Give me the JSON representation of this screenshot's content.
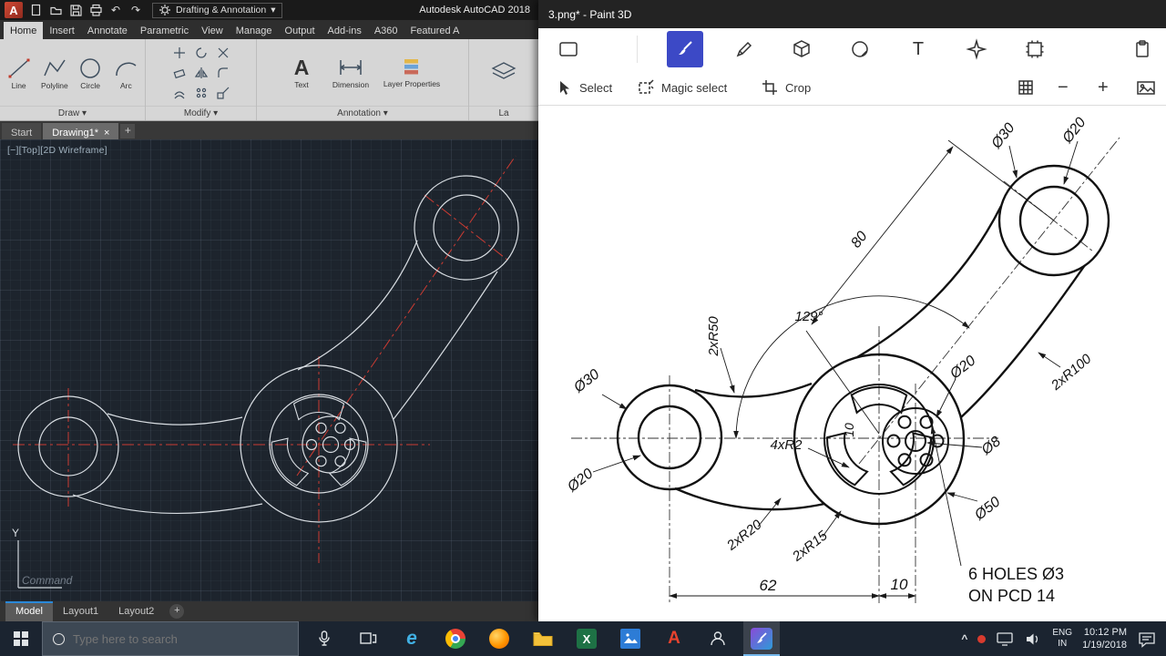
{
  "autocad": {
    "logo_letter": "A",
    "workspace_label": "Drafting & Annotation",
    "workspace_caret": "▾",
    "window_title": "Autodesk AutoCAD 2018",
    "icons": {
      "undo": "↶",
      "redo": "↷"
    },
    "tabs": [
      "Home",
      "Insert",
      "Annotate",
      "Parametric",
      "View",
      "Manage",
      "Output",
      "Add-ins",
      "A360",
      "Featured A"
    ],
    "panels": {
      "caret": "▾",
      "draw_label": "Draw",
      "modify_label": "Modify",
      "annotation_label": "Annotation",
      "layers_label": "La",
      "tools": {
        "line": "Line",
        "polyline": "Polyline",
        "circle": "Circle",
        "arc": "Arc",
        "text_glyph": "A",
        "text": "Text",
        "dimension": "Dimension",
        "layer_props": "Layer Properties"
      }
    },
    "file_tabs": {
      "start": "Start",
      "drawing": "Drawing1*",
      "close": "×",
      "add": "+"
    },
    "viewport_label": "[−][Top][2D Wireframe]",
    "ucs_y": "Y",
    "command_text": "Command",
    "layout": {
      "model": "Model",
      "layout1": "Layout1",
      "layout2": "Layout2",
      "add": "+"
    }
  },
  "paint3d": {
    "title": "3.png* - Paint 3D",
    "toolbar": {
      "text_glyph": "T"
    },
    "menu": {
      "select": "Select",
      "magic": "Magic select",
      "crop": "Crop"
    },
    "zoom": {
      "minus": "−",
      "plus": "+"
    },
    "dims": {
      "d30_top": "Ø30",
      "d20_top": "Ø20",
      "d80": "80",
      "a129": "129°",
      "r50": "2xR50",
      "d30_left": "Ø30",
      "d20_left": "Ø20",
      "r2": "4xR2",
      "d10_v": "10",
      "d20_hub": "Ø20",
      "r100": "2xR100",
      "d8": "Ø8",
      "d50": "Ø50",
      "r20": "2xR20",
      "r15": "2xR15",
      "d62": "62",
      "d10_h": "10",
      "note1": "6 HOLES Ø3",
      "note2": "ON PCD 14"
    }
  },
  "taskbar": {
    "search_placeholder": "Type here to search",
    "edge_glyph": "e",
    "excel_glyph": "X",
    "autocad_glyph": "A",
    "tray": {
      "chevron": "^",
      "lang": "ENG",
      "region": "IN",
      "time": "10:12 PM",
      "date": "1/19/2018"
    }
  }
}
